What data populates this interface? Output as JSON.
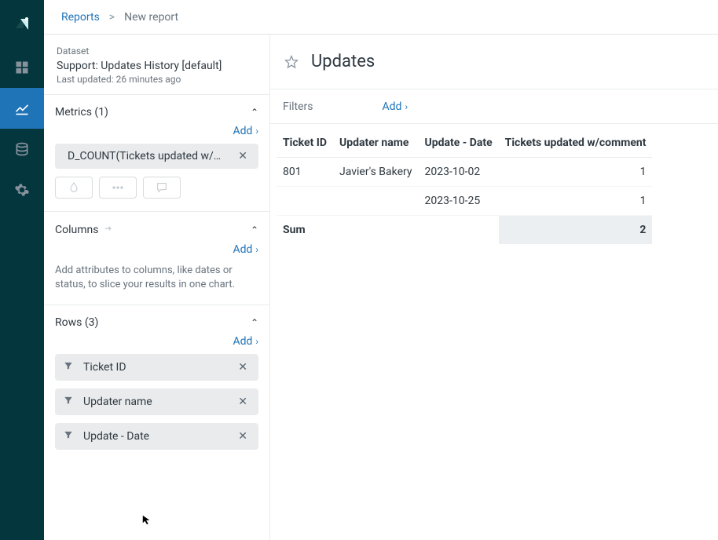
{
  "breadcrumb": {
    "root": "Reports",
    "sep": ">",
    "current": "New report"
  },
  "dataset": {
    "label": "Dataset",
    "name": "Support: Updates History [default]",
    "updated": "Last updated: 26 minutes ago"
  },
  "sections": {
    "metrics": {
      "title": "Metrics (1)",
      "add": "Add"
    },
    "columns": {
      "title": "Columns",
      "add": "Add",
      "hint": "Add attributes to columns, like dates or status, to slice your results in one chart."
    },
    "rows": {
      "title": "Rows (3)",
      "add": "Add"
    }
  },
  "metrics": {
    "chip": "D_COUNT(Tickets updated w/…"
  },
  "row_attrs": [
    "Ticket ID",
    "Updater name",
    "Update - Date"
  ],
  "report": {
    "title": "Updates",
    "filters_label": "Filters",
    "filters_add": "Add"
  },
  "table": {
    "headers": [
      "Ticket ID",
      "Updater name",
      "Update - Date",
      "Tickets updated w/comment"
    ],
    "rows": [
      {
        "ticket_id": "801",
        "updater": "Javier's Bakery",
        "date": "2023-10-02",
        "value": "1"
      },
      {
        "ticket_id": "",
        "updater": "",
        "date": "2023-10-25",
        "value": "1"
      }
    ],
    "sum_label": "Sum",
    "sum_value": "2"
  }
}
